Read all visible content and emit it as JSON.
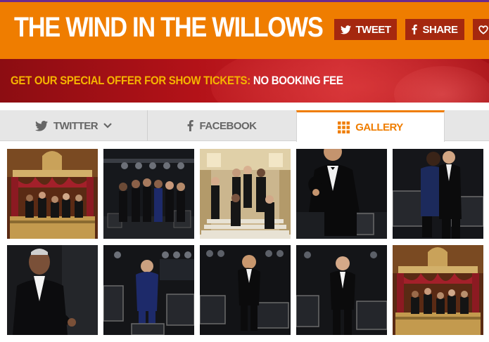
{
  "header": {
    "title": "THE WIND IN THE WILLOWS",
    "share_buttons": [
      {
        "label": "TWEET",
        "icon": "twitter-bird-icon"
      },
      {
        "label": "SHARE",
        "icon": "facebook-f-icon"
      },
      {
        "label": "",
        "icon": "heart-icon"
      }
    ]
  },
  "offer": {
    "highlight": "GET OUR SPECIAL OFFER FOR SHOW TICKETS:",
    "rest": "NO BOOKING FEE"
  },
  "tabs": [
    {
      "label": "TWITTER",
      "icon": "twitter-bird-icon",
      "active": false
    },
    {
      "label": "FACEBOOK",
      "icon": "facebook-f-icon",
      "active": false
    },
    {
      "label": "GALLERY",
      "icon": "grid-icon",
      "active": true
    }
  ],
  "colors": {
    "brand_orange": "#ef7d00",
    "offer_red": "#b31218",
    "offer_highlight": "#f5b400",
    "share_button": "#a5280f",
    "tab_bg": "#e6e6e6"
  },
  "gallery": {
    "rows": [
      [
        "theatre-box-cast-photo",
        "cast-group-backstage-photo",
        "cast-on-staircase-photo",
        "actor-seated-tuxedo-photo",
        "couple-seated-on-crates-photo"
      ],
      [
        "actor-portrait-smiling-photo",
        "actor-standing-crates-photo",
        "actor-on-crates-photo",
        "actor-standing-tuxedo-photo",
        "theatre-box-cast-photo"
      ]
    ]
  }
}
